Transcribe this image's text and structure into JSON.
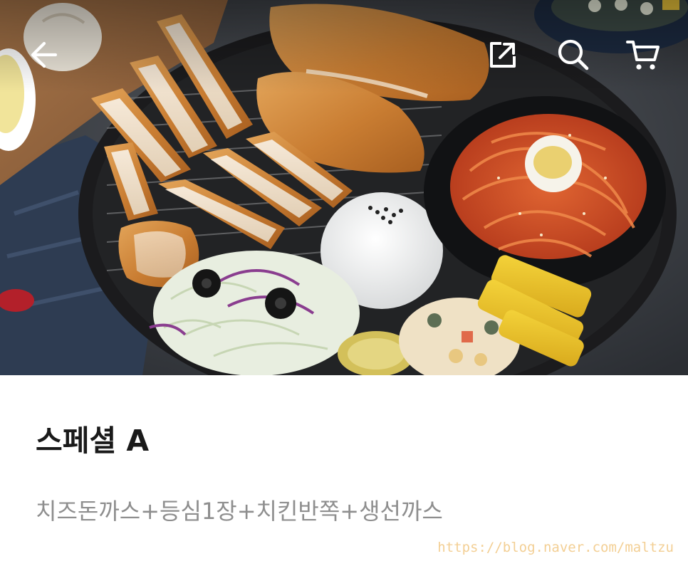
{
  "product": {
    "title": "스페셜 A",
    "description": "치즈돈까스+등심1장+치킨반쪽+생선까스"
  },
  "toolbar": {
    "back_icon": "arrow-left-icon",
    "share_icon": "share-external-icon",
    "search_icon": "search-icon",
    "cart_icon": "cart-icon"
  },
  "hero_image": {
    "subject": "food-platter-photo"
  },
  "watermark": {
    "text": "https://blog.naver.com/maltzu"
  },
  "colors": {
    "title": "#1a1a1a",
    "description": "#8e8e8e",
    "icon": "#ffffff",
    "watermark": "#f3cf94"
  }
}
